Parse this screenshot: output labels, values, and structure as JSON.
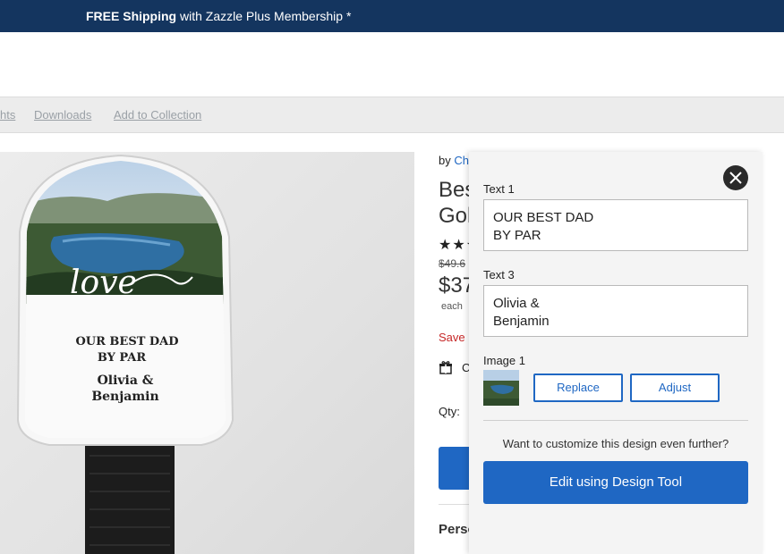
{
  "promo": {
    "bold": "FREE Shipping",
    "rest": " with Zazzle Plus Membership *"
  },
  "toolbar": {
    "items": [
      "hts",
      "Downloads",
      "Add to Collection"
    ]
  },
  "product_image": {
    "headcover_text_line1": "OUR BEST DAD",
    "headcover_text_line2": "BY PAR",
    "headcover_name_line1": "Olivia &",
    "headcover_name_line2": "Benjamin",
    "script_word": "love"
  },
  "product": {
    "by_prefix": "by ",
    "by_store": "Ch",
    "title": "Bes\nGol",
    "stars": "★★★",
    "old_price": "$49.6",
    "price": "$37",
    "each": "each",
    "save": "Save",
    "gift_icon": "gift-icon",
    "gift_text": "C",
    "qty_label": "Qty:",
    "personalize": "Perso"
  },
  "panel": {
    "close_icon": "close-icon",
    "text1_label": "Text 1",
    "text1_value": "OUR BEST DAD\nBY PAR",
    "text3_label": "Text 3",
    "text3_value": "Olivia &\nBenjamin",
    "image1_label": "Image 1",
    "replace": "Replace",
    "adjust": "Adjust",
    "further": "Want to customize this design even further?",
    "design_tool": "Edit using Design Tool"
  },
  "colors": {
    "promo_bg": "#14355f",
    "accent_blue": "#1f67c3",
    "sale_red": "#c62828"
  }
}
